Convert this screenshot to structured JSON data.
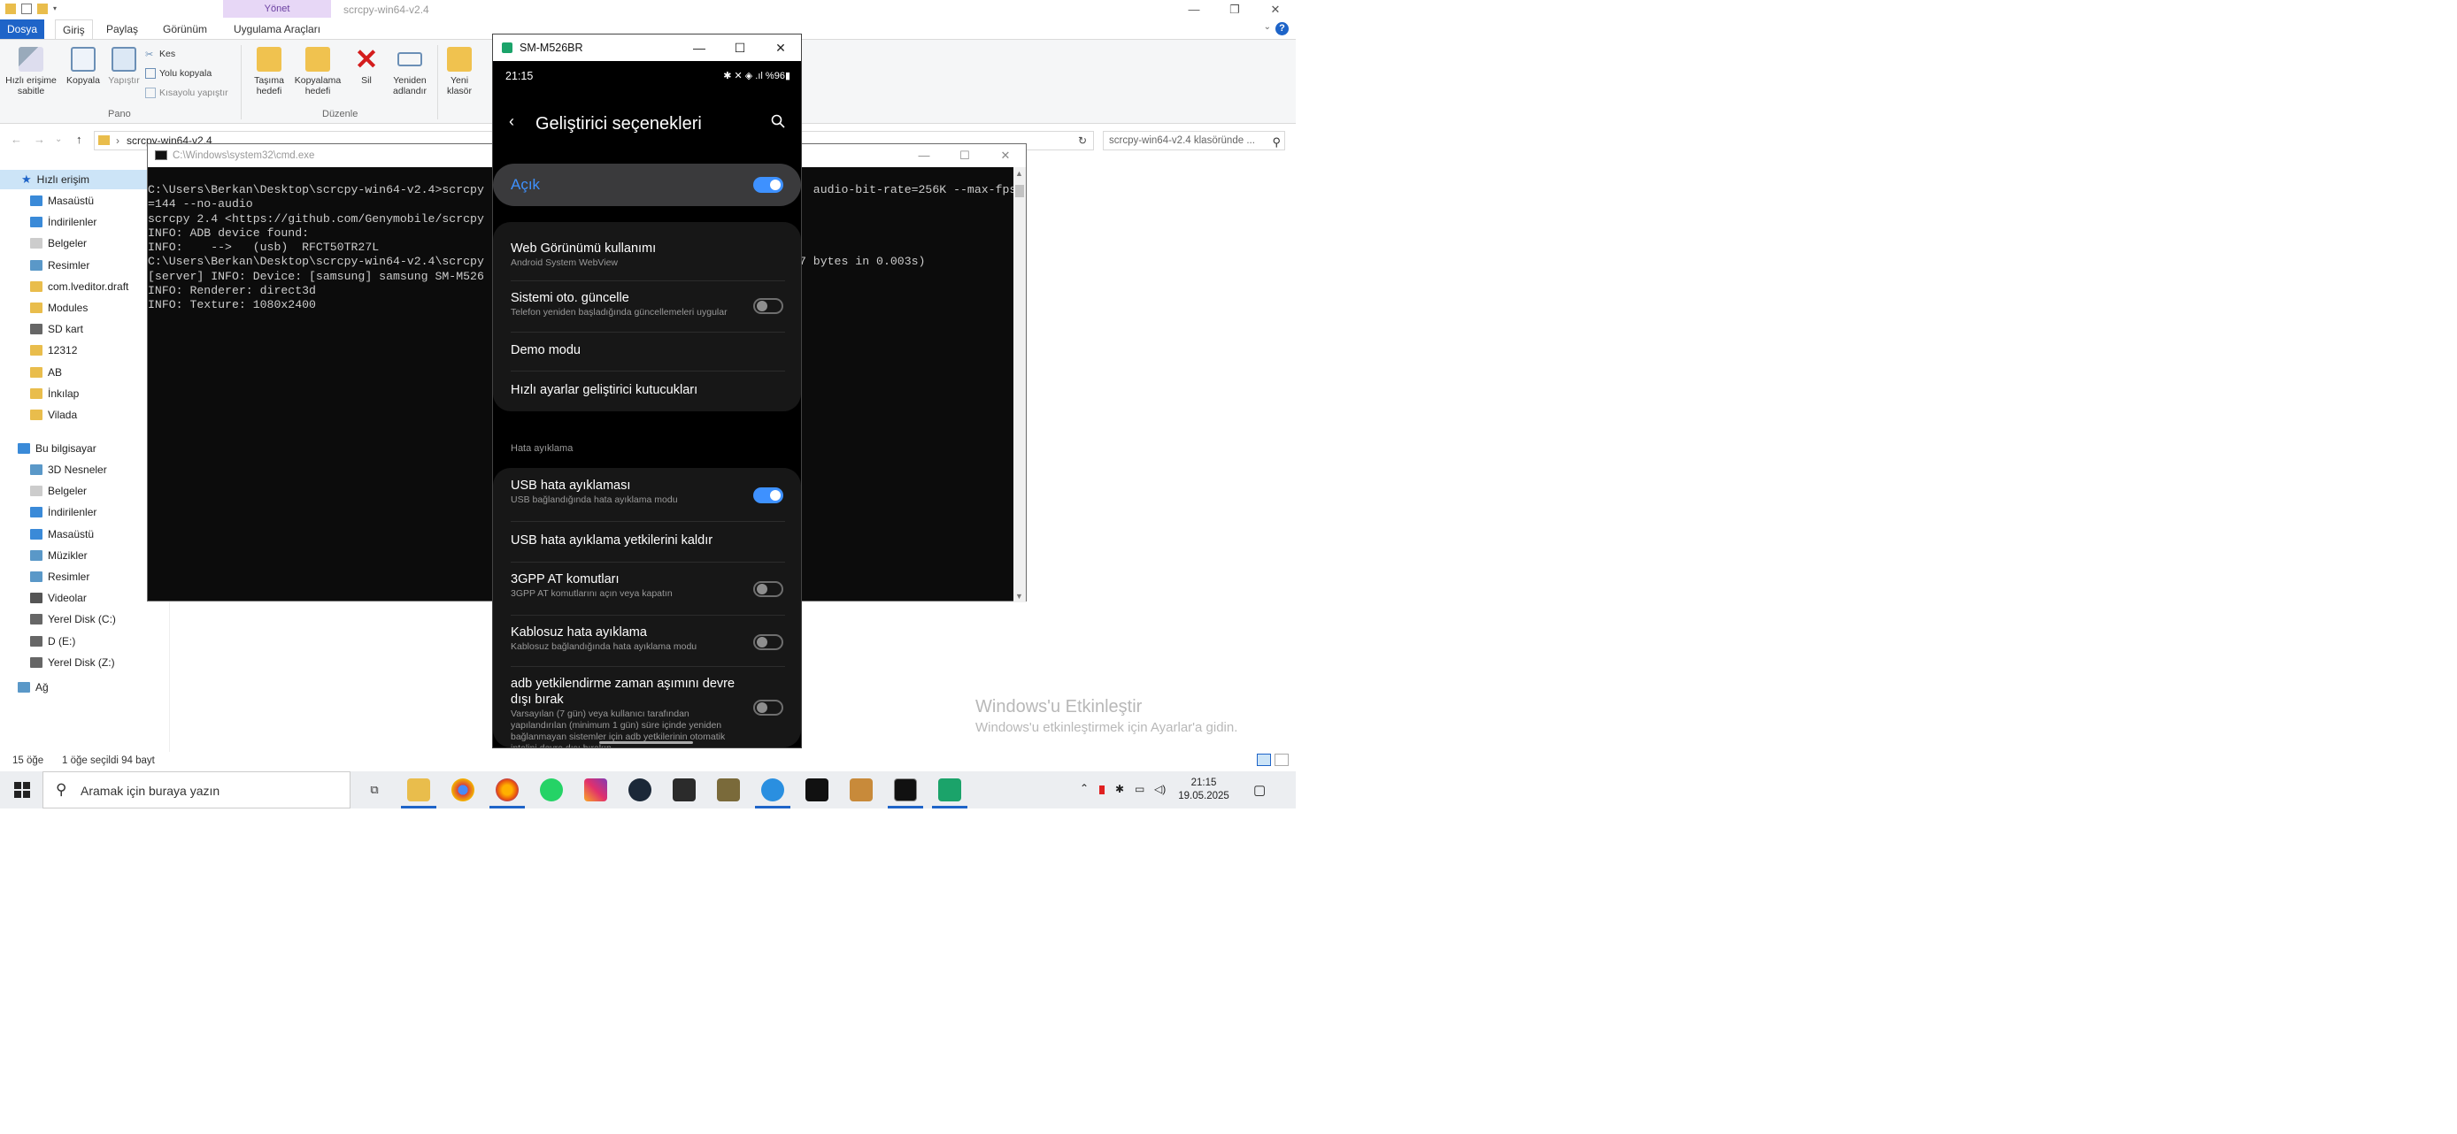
{
  "explorer": {
    "title": "scrcpy-win64-v2.4",
    "contextual_tab": "Yönet",
    "tabs": [
      "Dosya",
      "Giriş",
      "Paylaş",
      "Görünüm",
      "Uygulama Araçları"
    ],
    "ribbon": {
      "pin_label": "Hızlı erişime sabitle",
      "copy_label": "Kopyala",
      "paste_label": "Yapıştır",
      "cut_label": "Kes",
      "copy_path_label": "Yolu kopyala",
      "paste_shortcut_label": "Kısayolu yapıştır",
      "group_clipboard": "Pano",
      "move_to_label": "Taşıma hedefi",
      "copy_to_label": "Kopyalama hedefi",
      "delete_label": "Sil",
      "rename_label": "Yeniden adlandır",
      "new_folder_label": "Yeni klasör",
      "group_organize": "Düzenle"
    },
    "address": "scrcpy-win64-v2.4",
    "search_placeholder": "scrcpy-win64-v2.4 klasöründe ...",
    "nav": {
      "quick_access": "Hızlı erişim",
      "quick_items": [
        "Masaüstü",
        "İndirilenler",
        "Belgeler",
        "Resimler",
        "com.lveditor.draft",
        "Modules",
        "SD kart",
        "12312",
        "AB",
        "İnkılap",
        "Vilada"
      ],
      "this_pc": "Bu bilgisayar",
      "pc_items": [
        "3D Nesneler",
        "Belgeler",
        "İndirilenler",
        "Masaüstü",
        "Müzikler",
        "Resimler",
        "Videolar",
        "Yerel Disk (C:)",
        "D (E:)",
        "Yerel Disk (Z:)"
      ],
      "network": "Ağ"
    },
    "status": {
      "count": "15 öğe",
      "selection": "1 öğe seçildi  94 bayt"
    }
  },
  "cmd": {
    "title": "C:\\Windows\\system32\\cmd.exe",
    "lines": [
      "C:\\Users\\Berkan\\Desktop\\scrcpy-win64-v2.4>scrcpy                                               audio-bit-rate=256K --max-fps",
      "=144 --no-audio",
      "scrcpy 2.4 <https://github.com/Genymobile/scrcpy",
      "INFO: ADB device found:",
      "INFO:    -->   (usb)  RFCT50TR27L",
      "C:\\Users\\Berkan\\Desktop\\scrcpy-win64-v2.4\\scrcpy                                      s (69007 bytes in 0.003s)",
      "[server] INFO: Device: [samsung] samsung SM-M526",
      "INFO: Renderer: direct3d",
      "INFO: Texture: 1080x2400"
    ]
  },
  "phone": {
    "window_title": "SM-M526BR",
    "time": "21:15",
    "status_right": "✱ ✕ ◈ .ıl %96▮",
    "heading": "Geliştirici seçenekleri",
    "master_label": "Açık",
    "master_on": true,
    "rows_top": [
      {
        "title": "Web Görünümü kullanımı",
        "sub": "Android System WebView"
      },
      {
        "title": "Sistemi oto. güncelle",
        "sub": "Telefon yeniden başladığında güncellemeleri uygular",
        "toggle": false
      },
      {
        "title": "Demo modu"
      },
      {
        "title": "Hızlı ayarlar geliştirici kutucukları"
      }
    ],
    "section": "Hata ayıklama",
    "rows_debug": [
      {
        "title": "USB hata ayıklaması",
        "sub": "USB bağlandığında hata ayıklama modu",
        "toggle": true
      },
      {
        "title": "USB hata ayıklama yetkilerini kaldır"
      },
      {
        "title": "3GPP AT komutları",
        "sub": "3GPP AT komutlarını açın veya kapatın",
        "toggle": false
      },
      {
        "title": "Kablosuz hata ayıklama",
        "sub": "Kablosuz bağlandığında hata ayıklama modu",
        "toggle": false
      },
      {
        "title": "adb yetkilendirme zaman aşımını devre",
        "title2": "dışı bırak",
        "sub": "Varsayılan (7 gün) veya kullanıcı tarafından",
        "sub2": "yapılandırılan (minimum 1 gün) süre içinde yeniden",
        "sub3": "bağlanmayan sistemler için adb yetkilerinin otomatik",
        "sub4": "iptalini devre dışı bırakın.",
        "toggle": false
      }
    ]
  },
  "watermark": {
    "line1": "Windows'u Etkinleştir",
    "line2": "Windows'u etkinleştirmek için Ayarlar'a gidin."
  },
  "taskbar": {
    "search_placeholder": "Aramak için buraya yazın",
    "time": "21:15",
    "date": "19.05.2025"
  },
  "colors": {
    "accent": "#1e64c8",
    "phone_accent": "#3e91ff"
  }
}
